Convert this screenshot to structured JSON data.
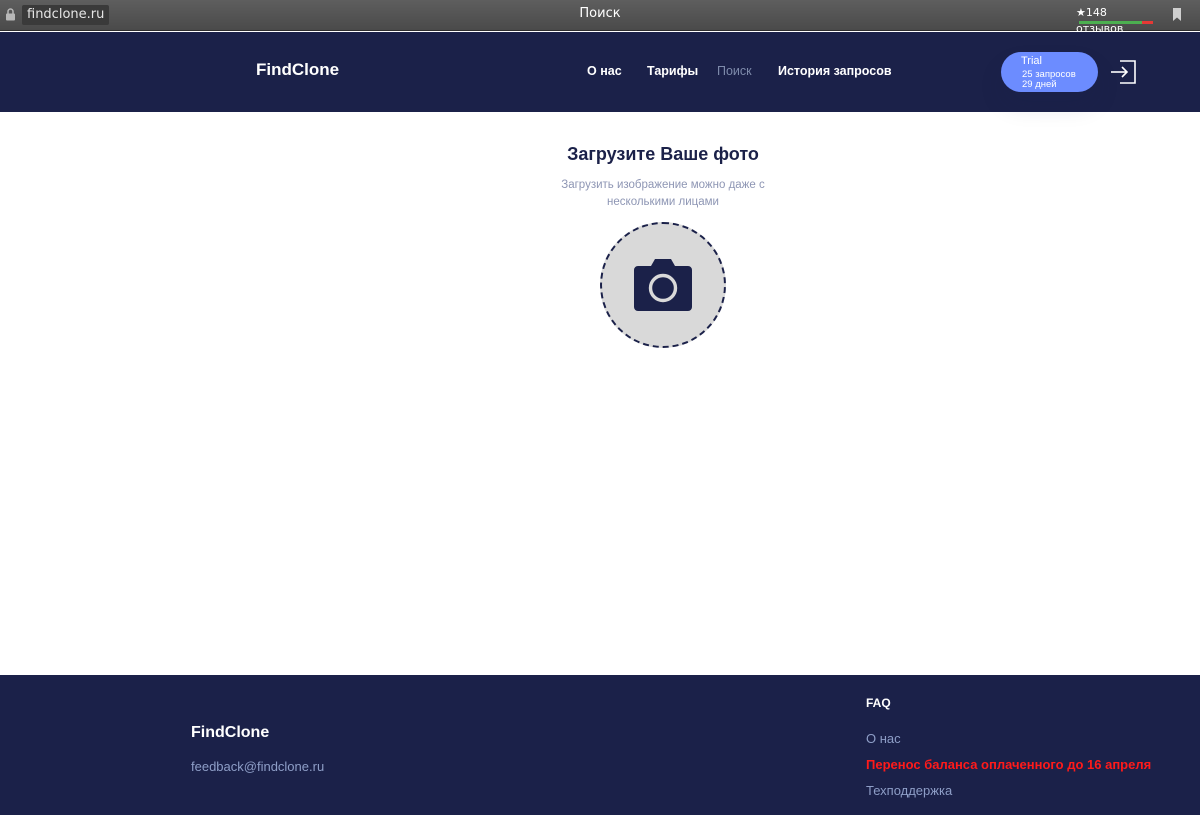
{
  "browser": {
    "url": "findclone.ru",
    "tab_title": "Поиск",
    "reviews_badge": "★148 отзывов",
    "icons": [
      "lock-icon",
      "bookmark-icon"
    ]
  },
  "header": {
    "logo": "FindClone",
    "nav": [
      {
        "label": "О нас",
        "active": false
      },
      {
        "label": "Тарифы",
        "active": false
      },
      {
        "label": "Поиск",
        "active": true
      },
      {
        "label": "История запросов",
        "active": false
      }
    ],
    "plan": {
      "name": "Trial",
      "requests": "25 запросов",
      "days": "29 дней"
    },
    "login_icon": "login-icon"
  },
  "main": {
    "title": "Загрузите Ваше фото",
    "subtitle_line1": "Загрузить изображение можно даже с",
    "subtitle_line2": "несколькими лицами",
    "upload_icon": "camera-icon"
  },
  "footer": {
    "logo": "FindClone",
    "email": "feedback@findclone.ru",
    "faq_title": "FAQ",
    "links": [
      {
        "label": "О нас"
      },
      {
        "label": "Перенос баланса оплаченного до 16 апреля"
      },
      {
        "label": "Техподдержка"
      }
    ]
  },
  "colors": {
    "navy": "#1b2149",
    "accent_blue": "#6c8cff",
    "muted_text": "#8e96b4",
    "alert_red": "#ff1a1a",
    "upload_bg": "#d9d9d9"
  }
}
